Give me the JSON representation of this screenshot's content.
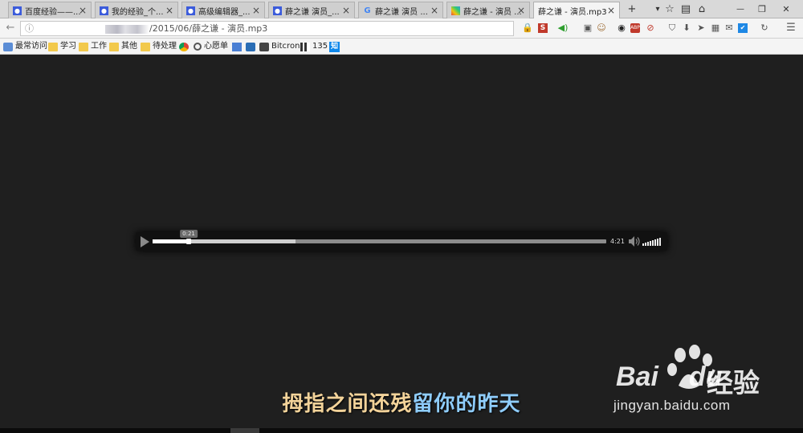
{
  "tabs": [
    {
      "label": "百度经验——...",
      "favicon": "baidu-paw-icon",
      "color": "#3b5bdb"
    },
    {
      "label": "我的经验_个...",
      "favicon": "baidu-paw-icon",
      "color": "#3b5bdb"
    },
    {
      "label": "高级编辑器_...",
      "favicon": "baidu-paw-icon",
      "color": "#3b5bdb"
    },
    {
      "label": "薛之谦 演员_...",
      "favicon": "baidu-paw-icon",
      "color": "#3b5bdb"
    },
    {
      "label": "薛之谦 演员 ...",
      "favicon": "google-g-icon",
      "color": "#4285f4"
    },
    {
      "label": "薛之谦 - 演员 ...",
      "favicon": "colorful-grid-icon",
      "color": "#e0a020"
    },
    {
      "label": "薛之谦 - 演员.mp3",
      "favicon": "none",
      "color": "#f4f4f4",
      "active": true
    }
  ],
  "strip": {
    "new_tab": "+",
    "tab_list": "▾",
    "min": "—",
    "restore": "❐",
    "close": "✕"
  },
  "navbar": {
    "url_path": "/2015/06/薛之谦 - 演员.mp3",
    "back_icon": "back-arrow-icon",
    "info_icon": "ⓘ",
    "refresh_icon": "↻",
    "menu_icon": "☰"
  },
  "bookmarks": [
    {
      "label": "最常访问",
      "icon": "globe-icon"
    },
    {
      "label": "学习",
      "icon": "folder-icon"
    },
    {
      "label": "工作",
      "icon": "folder-icon"
    },
    {
      "label": "其他",
      "icon": "folder-icon"
    },
    {
      "label": "待处理",
      "icon": "folder-icon"
    },
    {
      "label": "",
      "icon": "chrome-icon"
    },
    {
      "label": "心愿单",
      "icon": "tag-icon"
    },
    {
      "label": "",
      "icon": "translate-icon"
    },
    {
      "label": "",
      "icon": "shield-icon"
    },
    {
      "label": "Bitcron",
      "icon": "bitcron-icon"
    },
    {
      "label": "135",
      "icon": "135-icon"
    },
    {
      "label": "知",
      "icon": "zhihu-icon"
    }
  ],
  "player": {
    "current_time": "0:21",
    "duration": "4:21",
    "played_fraction": 0.0805,
    "buffered_fraction": 0.315,
    "volume_bars": 8
  },
  "subtitle": {
    "before": "拇指之间还残",
    "highlight": "留你的昨天"
  },
  "watermark": {
    "logo": "Bai",
    "logo_tail": "du",
    "cn": "经验",
    "url": "jingyan.baidu.com"
  },
  "colors": {
    "background": "#1f1f1f",
    "subtitle": "#f3d39a",
    "subtitle_highlight": "#8fcdfd"
  }
}
